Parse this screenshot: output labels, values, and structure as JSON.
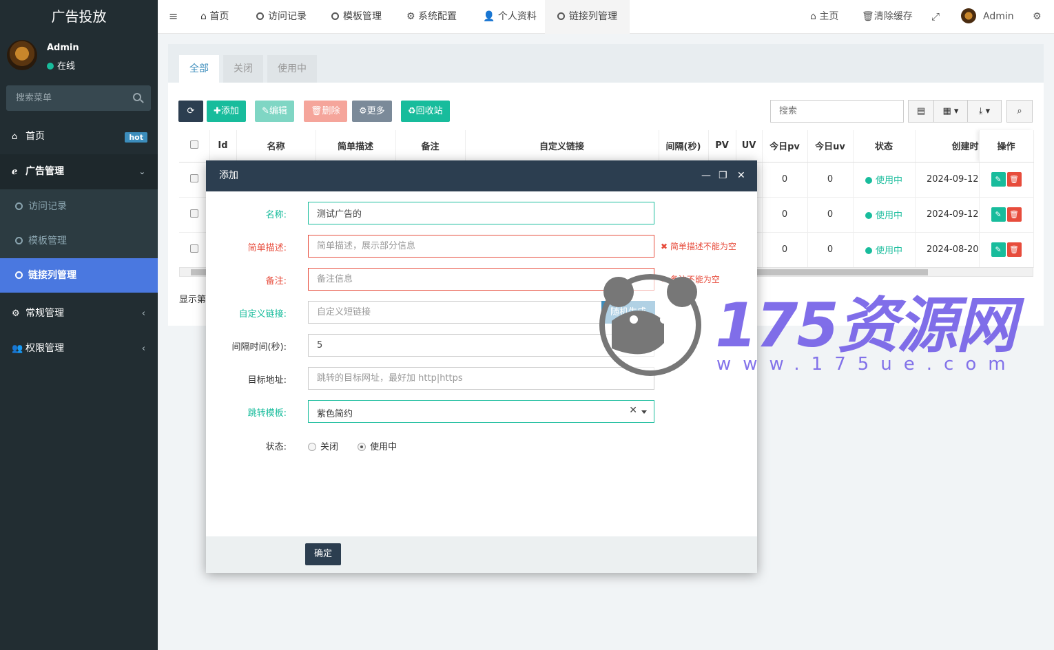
{
  "sidebar": {
    "brand": "广告投放",
    "user": {
      "name": "Admin",
      "status": "在线"
    },
    "search_placeholder": "搜索菜单",
    "home": {
      "label": "首页",
      "badge": "hot"
    },
    "ad_group": {
      "label": "广告管理"
    },
    "sub_items": [
      "访问记录",
      "模板管理",
      "链接列管理"
    ],
    "general": {
      "label": "常规管理"
    },
    "auth": {
      "label": "权限管理"
    }
  },
  "topnav": {
    "menu_icon": "≡",
    "tabs": [
      "首页",
      "访问记录",
      "模板管理",
      "系统配置",
      "个人资料",
      "链接列管理"
    ],
    "right": {
      "home": "主页",
      "clear_cache": "清除缓存",
      "admin": "Admin"
    }
  },
  "panel": {
    "tabs": [
      "全部",
      "关闭",
      "使用中"
    ],
    "buttons": {
      "add": "添加",
      "edit": "编辑",
      "delete": "删除",
      "more": "更多",
      "recycle": "回收站"
    },
    "search_placeholder": "搜索",
    "columns": [
      "Id",
      "名称",
      "简单描述",
      "备注",
      "自定义链接",
      "间隔(秒)",
      "PV",
      "UV",
      "今日pv",
      "今日uv",
      "状态",
      "创建时",
      "操作"
    ],
    "rows": [
      {
        "today_pv": "0",
        "today_uv": "0",
        "status": "使用中",
        "created": "2024-09-12"
      },
      {
        "today_pv": "0",
        "today_uv": "0",
        "status": "使用中",
        "created": "2024-09-12"
      },
      {
        "today_pv": "0",
        "today_uv": "0",
        "status": "使用中",
        "created": "2024-08-20"
      }
    ],
    "footer_text": "显示第"
  },
  "modal": {
    "title": "添加",
    "fields": {
      "name": {
        "label": "名称:",
        "value": "测试广告的"
      },
      "desc": {
        "label": "简单描述:",
        "placeholder": "简单描述，展示部分信息",
        "error": "简单描述不能为空"
      },
      "remark": {
        "label": "备注:",
        "placeholder": "备注信息",
        "error": "备注不能为空"
      },
      "link": {
        "label": "自定义链接:",
        "placeholder": "自定义短链接",
        "gen_button": "随机生成"
      },
      "interval": {
        "label": "间隔时间(秒):",
        "value": "5"
      },
      "target": {
        "label": "目标地址:",
        "placeholder": "跳转的目标网址，最好加 http|https"
      },
      "template": {
        "label": "跳转模板:",
        "value": "紫色简约"
      },
      "status": {
        "label": "状态:",
        "options": [
          "关闭",
          "使用中"
        ],
        "selected": "使用中"
      }
    },
    "confirm": "确定"
  },
  "watermark": {
    "title": "175资源网",
    "url": "www.175ue.com"
  },
  "colors": {
    "sidebar": "#222d32",
    "accent": "#18bc9c",
    "error": "#e74c3c",
    "active_menu": "#4a78e0",
    "modal_header": "#2c3e50"
  }
}
